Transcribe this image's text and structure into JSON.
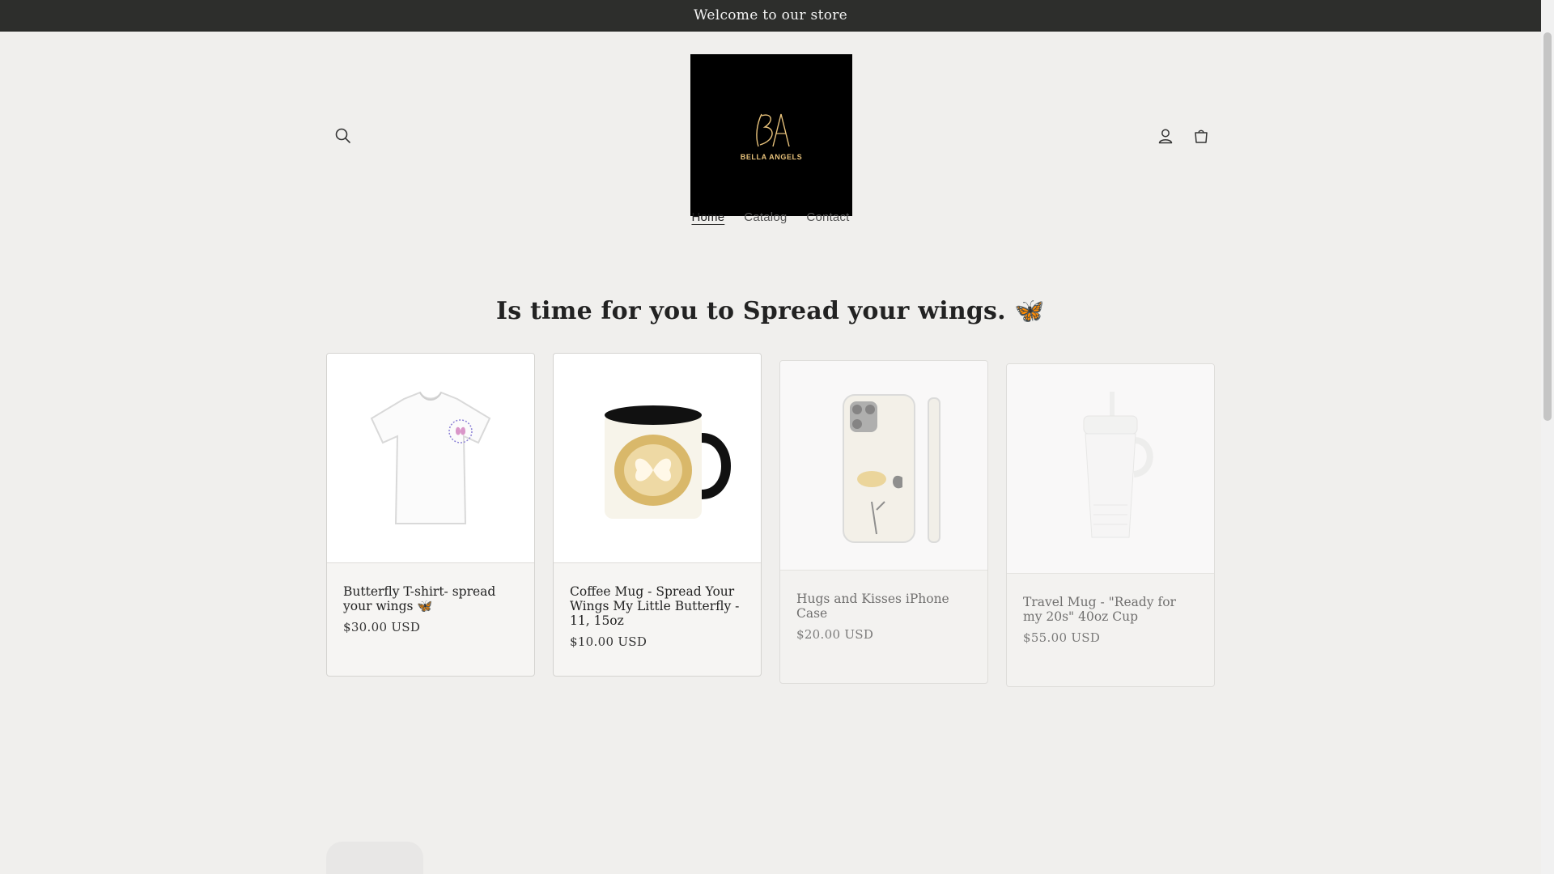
{
  "announcement": "Welcome to our store",
  "logo": {
    "text": "BELLA ANGELS",
    "monogram": "BA",
    "accent": "#e8c27b"
  },
  "header": {
    "search_icon": "search-icon",
    "account_icon": "account-icon",
    "cart_icon": "cart-icon"
  },
  "nav": [
    {
      "label": "Home",
      "active": true
    },
    {
      "label": "Catalog",
      "active": false
    },
    {
      "label": "Contact",
      "active": false
    }
  ],
  "section_heading": "Is time for you to Spread your wings. 🦋",
  "products": [
    {
      "title": "Butterfly T-shirt- spread your wings 🦋",
      "price": "$30.00 USD",
      "image": "t-shirt-image"
    },
    {
      "title": "Coffee Mug - Spread Your Wings My Little Butterfly - 11, 15oz",
      "price": "$10.00 USD",
      "image": "mug-image"
    },
    {
      "title": "Hugs and Kisses iPhone Case",
      "price": "$20.00 USD",
      "image": "phone-case-image"
    },
    {
      "title": "Travel Mug - \"Ready for my 20s\" 40oz Cup",
      "price": "$55.00 USD",
      "image": "travel-mug-image"
    }
  ],
  "colors": {
    "background": "#f0efed",
    "announcement_bar": "#2d2e2c"
  }
}
